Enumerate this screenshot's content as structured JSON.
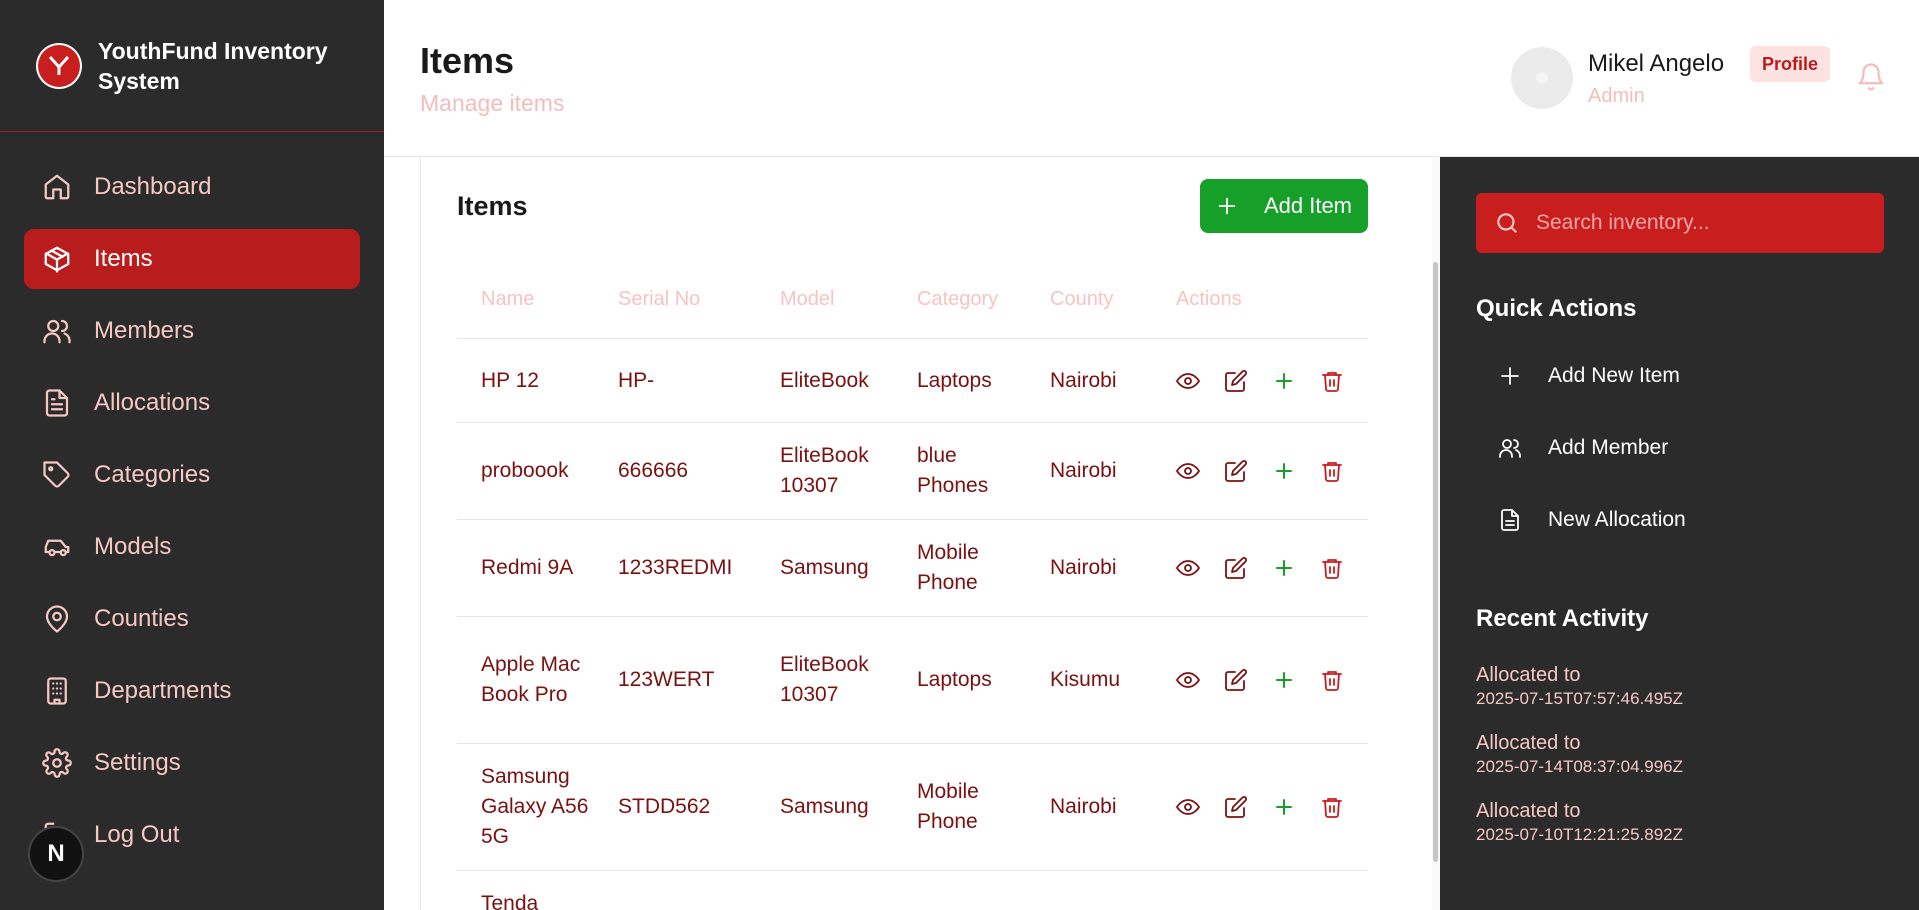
{
  "brand": {
    "line1": "YouthFund Inventory",
    "line2": "System"
  },
  "sidebar": {
    "items": [
      {
        "label": "Dashboard",
        "icon": "home-icon"
      },
      {
        "label": "Items",
        "icon": "package-icon",
        "active": true
      },
      {
        "label": "Members",
        "icon": "users-icon"
      },
      {
        "label": "Allocations",
        "icon": "file-text-icon"
      },
      {
        "label": "Categories",
        "icon": "tag-icon"
      },
      {
        "label": "Models",
        "icon": "car-icon"
      },
      {
        "label": "Counties",
        "icon": "map-pin-icon"
      },
      {
        "label": "Departments",
        "icon": "building-icon"
      },
      {
        "label": "Settings",
        "icon": "gear-icon"
      },
      {
        "label": "Log Out",
        "icon": "logout-icon"
      }
    ],
    "dev_badge": "N"
  },
  "header": {
    "title": "Items",
    "subtitle": "Manage items",
    "user_name": "Mikel Angelo",
    "user_role": "Admin",
    "profile_label": "Profile"
  },
  "card": {
    "title": "Items",
    "add_label": "Add Item",
    "columns": [
      "Name",
      "Serial No",
      "Model",
      "Category",
      "County",
      "Actions"
    ],
    "rows": [
      {
        "name": "HP 12",
        "serial": "HP-",
        "model": "EliteBook",
        "category": "Laptops",
        "county": "Nairobi"
      },
      {
        "name": "proboook",
        "serial": "666666",
        "model": "EliteBook 10307",
        "category": "blue Phones",
        "county": "Nairobi"
      },
      {
        "name": "Redmi 9A",
        "serial": "1233REDMI",
        "model": "Samsung",
        "category": "Mobile Phone",
        "county": "Nairobi"
      },
      {
        "name": "Apple Mac Book Pro",
        "serial": "123WERT",
        "model": "EliteBook 10307",
        "category": "Laptops",
        "county": "Kisumu"
      },
      {
        "name": "Samsung Galaxy A56 5G",
        "serial": "STDD562",
        "model": "Samsung",
        "category": "Mobile Phone",
        "county": "Nairobi"
      },
      {
        "name": "Tenda",
        "serial": "",
        "model": "",
        "category": "",
        "county": ""
      }
    ]
  },
  "right_panel": {
    "search_placeholder": "Search inventory...",
    "quick_actions_title": "Quick Actions",
    "quick_actions": [
      "Add New Item",
      "Add Member",
      "New Allocation"
    ],
    "recent_title": "Recent Activity",
    "recent": [
      {
        "label": "Allocated to",
        "time": "2025-07-15T07:57:46.495Z"
      },
      {
        "label": "Allocated to",
        "time": "2025-07-14T08:37:04.996Z"
      },
      {
        "label": "Allocated to",
        "time": "2025-07-10T12:21:25.892Z"
      }
    ]
  },
  "colors": {
    "sidebar_bg": "#2b2b2b",
    "accent_red": "#b91c1c",
    "green": "#16a02a",
    "text_dark_red": "#7a1010",
    "muted_pink": "#f5bcbc"
  }
}
